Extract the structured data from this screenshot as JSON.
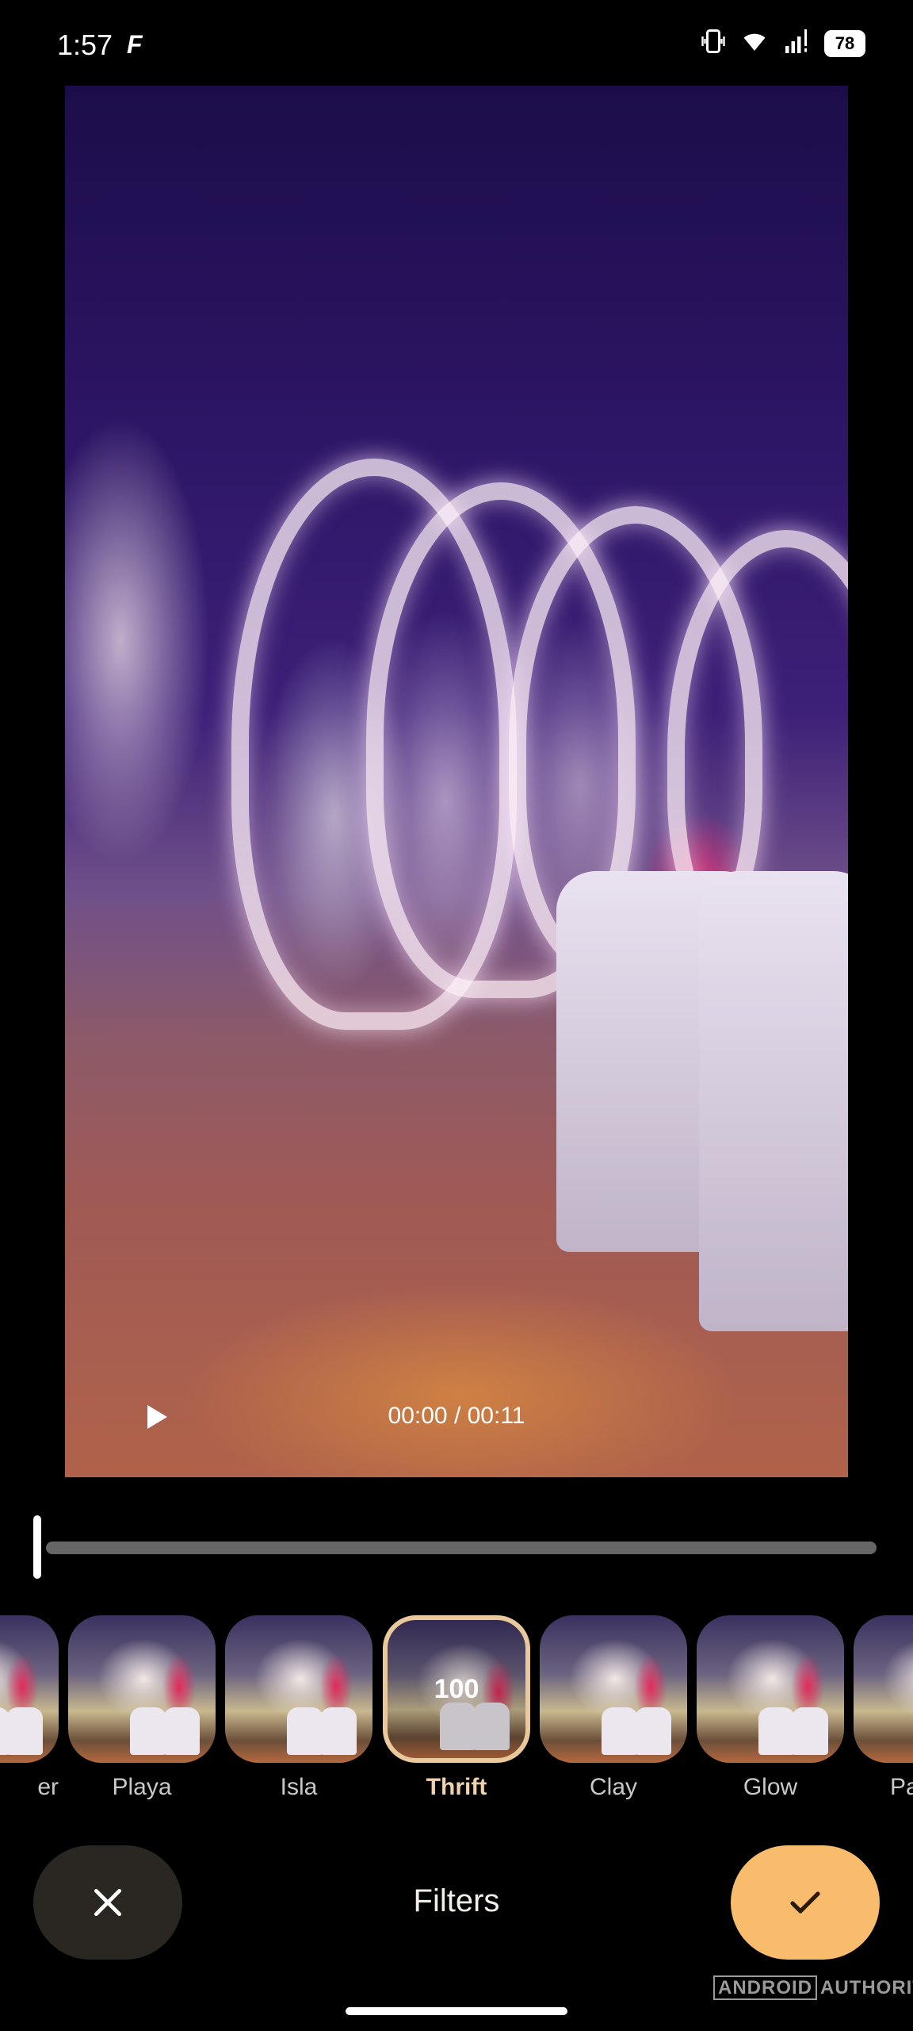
{
  "status_bar": {
    "time": "1:57",
    "app_glyph": "F",
    "battery": "78",
    "icons": [
      "vibrate-icon",
      "wifi-icon",
      "cell-signal-icon",
      "battery-icon"
    ]
  },
  "player": {
    "time_readout": "00:00 / 00:11",
    "progress": 0.0
  },
  "filters": {
    "items": [
      {
        "label": "er"
      },
      {
        "label": "Playa"
      },
      {
        "label": "Isla"
      },
      {
        "label": "Thrift",
        "selected": true,
        "value": "100"
      },
      {
        "label": "Clay"
      },
      {
        "label": "Glow"
      },
      {
        "label": "Pa"
      }
    ]
  },
  "bottom_bar": {
    "title": "Filters",
    "cancel_icon": "close-icon",
    "confirm_icon": "check-icon"
  },
  "watermark": {
    "part1": "ANDROID",
    "part2": "AUTHORITY"
  },
  "colors": {
    "accent": "#f8bc6c",
    "selected_label": "#f0d3ae",
    "cancel_bg": "#2a2722"
  }
}
